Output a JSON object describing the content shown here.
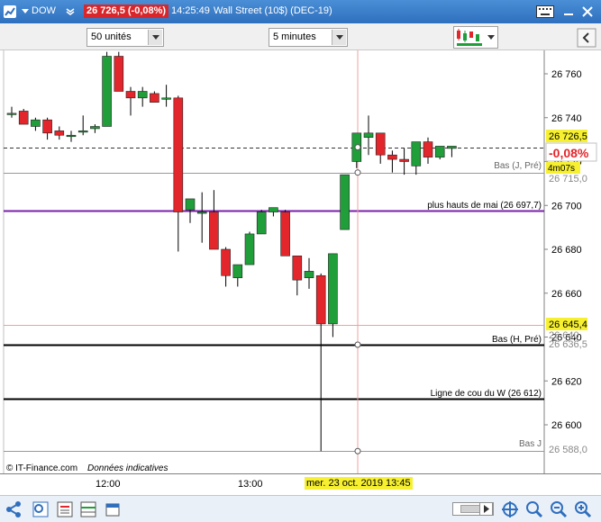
{
  "window": {
    "symbol": "DOW",
    "price_badge": "26 726,5 (-0,08%)",
    "time": "14:25:49",
    "instrument": "Wall Street (10$) (DEC-19)"
  },
  "toolbar": {
    "units_select": "50 unités",
    "interval_select": "5 minutes"
  },
  "chart": {
    "y_ticks": [
      "26 760",
      "26 740",
      "26 720",
      "26 700",
      "26 680",
      "26 660",
      "26 640",
      "26 620",
      "26 600"
    ],
    "y_tick_values": [
      26760,
      26740,
      26720,
      26700,
      26680,
      26660,
      26640,
      26620,
      26600
    ],
    "x_ticks": [
      "12:00",
      "13:00"
    ],
    "cursor_time_label": "mer. 23 oct. 2019 13:45",
    "current_price_label": "26 726,5",
    "change_label": "-0,08%",
    "timer_label": "4m07s",
    "level_715_label": "26 715,0",
    "level_645_label": "26 645,4",
    "level_640_label": "26 640",
    "level_636_label": "26 636,5",
    "level_588_label": "26 588,0",
    "line_bas_jpre": "Bas (J, Pré)",
    "line_hauts_mai": "plus hauts de mai (26 697,7)",
    "line_bas_hpre": "Bas (H, Pré)",
    "line_ligne_cou": "Ligne de cou du W (26 612)",
    "line_bas_j": "Bas J",
    "footer_copyright": "© IT-Finance.com",
    "footer_note": "Données indicatives",
    "colors": {
      "up": "#1f9e3a",
      "down": "#e3262b",
      "hauts_mai": "#7a1fa8",
      "cursor": "#f0a0a0"
    }
  },
  "chart_data": {
    "type": "candlestick",
    "ylim": [
      26588,
      26774
    ],
    "candles": [
      {
        "o": 26742,
        "h": 26745,
        "l": 26740,
        "c": 26742
      },
      {
        "o": 26743,
        "h": 26744,
        "l": 26737,
        "c": 26737
      },
      {
        "o": 26736,
        "h": 26740,
        "l": 26734,
        "c": 26739
      },
      {
        "o": 26739,
        "h": 26740,
        "l": 26730,
        "c": 26733
      },
      {
        "o": 26734,
        "h": 26736,
        "l": 26730,
        "c": 26732
      },
      {
        "o": 26732,
        "h": 26734,
        "l": 26729,
        "c": 26732
      },
      {
        "o": 26734,
        "h": 26741,
        "l": 26732,
        "c": 26734
      },
      {
        "o": 26735,
        "h": 26737,
        "l": 26733,
        "c": 26736
      },
      {
        "o": 26736,
        "h": 26770,
        "l": 26736,
        "c": 26768
      },
      {
        "o": 26768,
        "h": 26770,
        "l": 26752,
        "c": 26752
      },
      {
        "o": 26752,
        "h": 26754,
        "l": 26741,
        "c": 26749
      },
      {
        "o": 26749,
        "h": 26754,
        "l": 26745,
        "c": 26752
      },
      {
        "o": 26751,
        "h": 26752,
        "l": 26747,
        "c": 26747
      },
      {
        "o": 26749,
        "h": 26755,
        "l": 26745,
        "c": 26749
      },
      {
        "o": 26749,
        "h": 26750,
        "l": 26679,
        "c": 26697
      },
      {
        "o": 26698,
        "h": 26701,
        "l": 26692,
        "c": 26703
      },
      {
        "o": 26697,
        "h": 26706,
        "l": 26683,
        "c": 26697
      },
      {
        "o": 26697,
        "h": 26707,
        "l": 26680,
        "c": 26680
      },
      {
        "o": 26680,
        "h": 26681,
        "l": 26663,
        "c": 26668
      },
      {
        "o": 26667,
        "h": 26672,
        "l": 26663,
        "c": 26673
      },
      {
        "o": 26673,
        "h": 26688,
        "l": 26673,
        "c": 26687
      },
      {
        "o": 26687,
        "h": 26698,
        "l": 26687,
        "c": 26697
      },
      {
        "o": 26697,
        "h": 26699,
        "l": 26695,
        "c": 26699
      },
      {
        "o": 26697,
        "h": 26698,
        "l": 26677,
        "c": 26677
      },
      {
        "o": 26677,
        "h": 26677,
        "l": 26659,
        "c": 26666
      },
      {
        "o": 26667,
        "h": 26676,
        "l": 26662,
        "c": 26670
      },
      {
        "o": 26668,
        "h": 26669,
        "l": 26588,
        "c": 26646
      },
      {
        "o": 26646,
        "h": 26678,
        "l": 26640,
        "c": 26678
      },
      {
        "o": 26689,
        "h": 26714,
        "l": 26689,
        "c": 26714
      },
      {
        "o": 26720,
        "h": 26733,
        "l": 26717,
        "c": 26733
      },
      {
        "o": 26731,
        "h": 26741,
        "l": 26723,
        "c": 26733
      },
      {
        "o": 26733,
        "h": 26733,
        "l": 26719,
        "c": 26723
      },
      {
        "o": 26723,
        "h": 26725,
        "l": 26715,
        "c": 26721
      },
      {
        "o": 26721,
        "h": 26726,
        "l": 26714,
        "c": 26720
      },
      {
        "o": 26718,
        "h": 26729,
        "l": 26714,
        "c": 26729
      },
      {
        "o": 26729,
        "h": 26731,
        "l": 26719,
        "c": 26722
      },
      {
        "o": 26722,
        "h": 26726,
        "l": 26721,
        "c": 26727
      },
      {
        "o": 26726,
        "h": 26727,
        "l": 26722,
        "c": 26727
      }
    ],
    "h_levels": [
      {
        "y": 26726.5,
        "style": "dashed",
        "color": "#333333"
      },
      {
        "y": 26715.0,
        "style": "solid",
        "color": "#999999"
      },
      {
        "y": 26697.7,
        "style": "solid",
        "color": "#7a1fa8"
      },
      {
        "y": 26645.4,
        "style": "solid",
        "color": "#f0a0a0"
      },
      {
        "y": 26636.5,
        "style": "solid",
        "color": "#000000"
      },
      {
        "y": 26612,
        "style": "solid",
        "color": "#000000"
      },
      {
        "y": 26588.0,
        "style": "solid",
        "color": "#999999"
      }
    ]
  }
}
